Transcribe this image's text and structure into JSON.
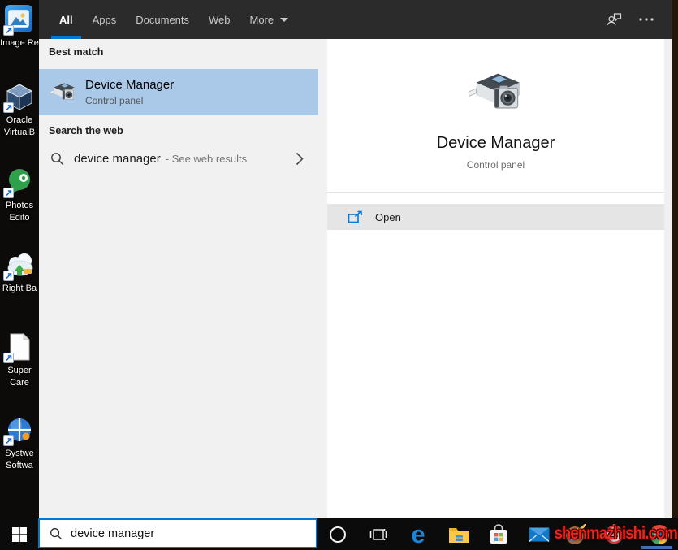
{
  "header": {
    "tabs": [
      "All",
      "Apps",
      "Documents",
      "Web",
      "More"
    ],
    "active_tab": "All"
  },
  "left_panel": {
    "section1_heading": "Best match",
    "best_match": {
      "title": "Device Manager",
      "subtitle": "Control panel"
    },
    "section2_heading": "Search the web",
    "web_result": {
      "query": "device manager",
      "annotation": "- See web results"
    }
  },
  "preview": {
    "title": "Device Manager",
    "subtitle": "Control panel",
    "open_label": "Open"
  },
  "taskbar": {
    "search_value": "device manager",
    "icons": [
      "start",
      "search-box",
      "cortana",
      "task-view",
      "edge",
      "file-explorer",
      "microsoft-store",
      "mail",
      "photos-editor",
      "clock",
      "chrome"
    ]
  },
  "desktop": {
    "icons": [
      {
        "name": "image-resizer",
        "line1": "Image Re",
        "line2": ""
      },
      {
        "name": "oracle-virtualbox",
        "line1": "Oracle",
        "line2": "VirtualB"
      },
      {
        "name": "photos-editor",
        "line1": "Photos",
        "line2": "Edito"
      },
      {
        "name": "right-backup",
        "line1": "Right Ba",
        "line2": ""
      },
      {
        "name": "super-care",
        "line1": "Super",
        "line2": "Care"
      },
      {
        "name": "systweak-software",
        "line1": "Systwe",
        "line2": "Softwa"
      }
    ]
  },
  "watermark": "shenmazhishi.com",
  "colors": {
    "accent": "#0078d7",
    "highlight": "#aac9e8",
    "taskbar": "#0b0b0b",
    "watermark_red": "#f2231d"
  }
}
